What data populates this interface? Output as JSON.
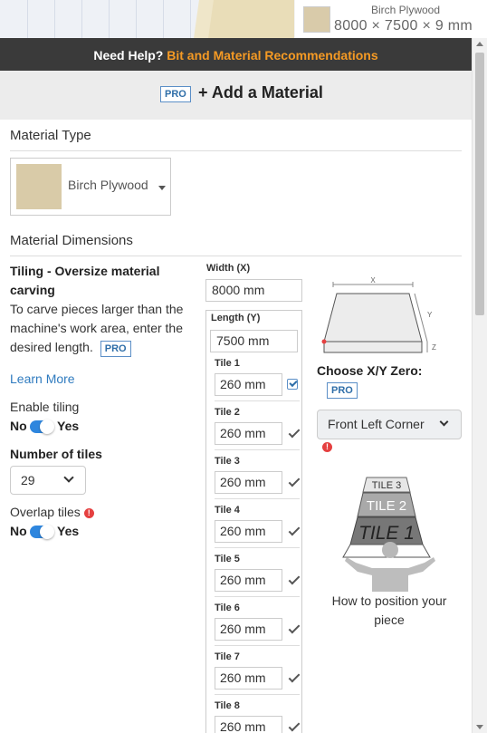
{
  "preview": {
    "material_name": "Birch Plywood",
    "dimensions": "8000 × 7500 × 9 mm"
  },
  "helpbar": {
    "prefix": "Need Help?",
    "link": "Bit and Material Recommendations"
  },
  "header": {
    "pro_badge": "PRO",
    "add_material": "+ Add a Material"
  },
  "material_type": {
    "title": "Material Type",
    "selected": "Birch Plywood"
  },
  "dimensions": {
    "title": "Material Dimensions"
  },
  "tiling": {
    "title": "Tiling - Oversize material carving",
    "description": "To carve pieces larger than the machine's work area, enter the desired length.",
    "pro_badge": "PRO",
    "learn_more": "Learn More",
    "enable_label": "Enable tiling",
    "enable_no": "No",
    "enable_yes": "Yes",
    "num_tiles_label": "Number of tiles",
    "num_tiles_value": "29",
    "overlap_label": "Overlap tiles",
    "overlap_no": "No",
    "overlap_yes": "Yes"
  },
  "width": {
    "label": "Width (X)",
    "value": "8000 mm"
  },
  "length": {
    "label": "Length (Y)",
    "value": "7500 mm"
  },
  "tiles": [
    {
      "label": "Tile 1",
      "value": "260 mm"
    },
    {
      "label": "Tile 2",
      "value": "260 mm"
    },
    {
      "label": "Tile 3",
      "value": "260 mm"
    },
    {
      "label": "Tile 4",
      "value": "260 mm"
    },
    {
      "label": "Tile 5",
      "value": "260 mm"
    },
    {
      "label": "Tile 6",
      "value": "260 mm"
    },
    {
      "label": "Tile 7",
      "value": "260 mm"
    },
    {
      "label": "Tile 8",
      "value": "260 mm"
    }
  ],
  "diagram": {
    "axis_x": "X",
    "axis_y": "Y",
    "axis_z": "Z"
  },
  "zero": {
    "title": "Choose X/Y Zero:",
    "pro_badge": "PRO",
    "selected": "Front Left Corner"
  },
  "position_illustration": {
    "tile1": "TILE 1",
    "tile2": "TILE 2",
    "tile3": "TILE 3",
    "caption": "How to position your piece"
  },
  "colors": {
    "accent": "#2e86de",
    "link_orange": "#f59a24",
    "helpbar_bg": "#3a3a3a",
    "pro_blue": "#2f6ea8",
    "warning": "#e54040"
  }
}
